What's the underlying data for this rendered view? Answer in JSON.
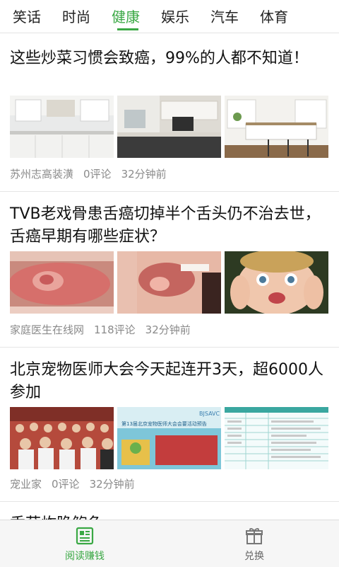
{
  "tabs": [
    "笑话",
    "时尚",
    "健康",
    "娱乐",
    "汽车",
    "体育"
  ],
  "active_tab_index": 2,
  "colors": {
    "accent": "#3aa844",
    "meta": "#8a8a8a",
    "divider": "#e6e6e6"
  },
  "articles": [
    {
      "title": "这些炒菜习惯会致癌，99%的人都不知道！",
      "source": "苏州志高装潢",
      "comments": "0评论",
      "time": "32分钟前"
    },
    {
      "title": "TVB老戏骨患舌癌切掉半个舌头仍不治去世，舌癌早期有哪些症状？",
      "source": "家庭医生在线网",
      "comments": "118评论",
      "time": "32分钟前"
    },
    {
      "title": "北京宠物医师大会今天起连开3天，超6000人参加",
      "source": "宠业家",
      "comments": "0评论",
      "time": "32分钟前",
      "poster_badge": "BJSAVC",
      "poster_title": "第13届北京宠物医师大会会要活动预告"
    },
    {
      "title": "香菇炸脆鲍鱼"
    }
  ],
  "bottom_nav": [
    {
      "label": "阅读赚钱",
      "icon": "newspaper-icon"
    },
    {
      "label": "兑换",
      "icon": "gift-box-icon"
    }
  ]
}
